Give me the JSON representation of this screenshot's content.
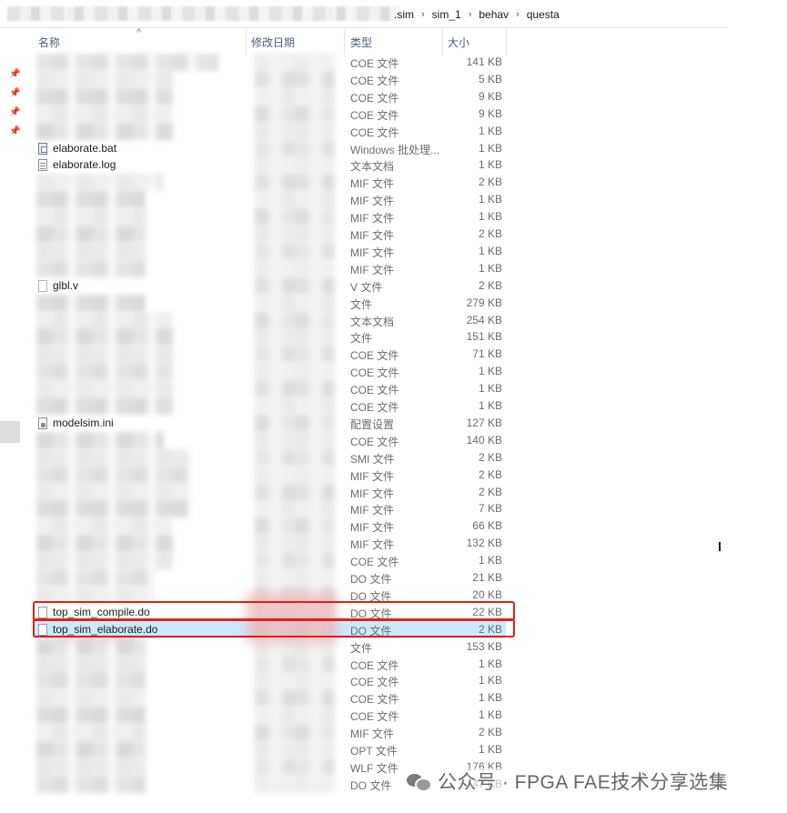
{
  "breadcrumb": {
    "segments": [
      ".sim",
      "sim_1",
      "behav",
      "questa"
    ]
  },
  "columns": {
    "name": "名称",
    "date": "修改日期",
    "type": "类型",
    "size": "大小"
  },
  "watermark": {
    "text": "公众号 · FPGA FAE技术分享选集"
  },
  "rows": [
    {
      "name": "",
      "type": "COE 文件",
      "size": "141 KB",
      "icon": "",
      "blur_w": 200
    },
    {
      "name": "",
      "type": "COE 文件",
      "size": "5 KB",
      "icon": "",
      "blur_w": 150
    },
    {
      "name": "",
      "type": "COE 文件",
      "size": "9 KB",
      "icon": "",
      "blur_w": 150
    },
    {
      "name": "",
      "type": "COE 文件",
      "size": "9 KB",
      "icon": "",
      "blur_w": 150
    },
    {
      "name": "",
      "type": "COE 文件",
      "size": "1 KB",
      "icon": "",
      "blur_w": 150
    },
    {
      "name": "elaborate.bat",
      "type": "Windows 批处理...",
      "size": "1 KB",
      "icon": "bat"
    },
    {
      "name": "elaborate.log",
      "type": "文本文档",
      "size": "1 KB",
      "icon": "log"
    },
    {
      "name": "",
      "type": "MIF 文件",
      "size": "2 KB",
      "icon": "",
      "blur_w": 140
    },
    {
      "name": "",
      "type": "MIF 文件",
      "size": "1 KB",
      "icon": "",
      "blur_w": 120
    },
    {
      "name": "",
      "type": "MIF 文件",
      "size": "1 KB",
      "icon": "",
      "blur_w": 120
    },
    {
      "name": "",
      "type": "MIF 文件",
      "size": "2 KB",
      "icon": "",
      "blur_w": 120
    },
    {
      "name": "",
      "type": "MIF 文件",
      "size": "1 KB",
      "icon": "",
      "blur_w": 120
    },
    {
      "name": "",
      "type": "MIF 文件",
      "size": "1 KB",
      "icon": "",
      "blur_w": 120
    },
    {
      "name": "glbl.v",
      "type": "V 文件",
      "size": "2 KB",
      "icon": "v"
    },
    {
      "name": "",
      "type": "文件",
      "size": "279 KB",
      "icon": "",
      "blur_w": 120
    },
    {
      "name": "",
      "type": "文本文档",
      "size": "254 KB",
      "icon": "",
      "blur_w": 150
    },
    {
      "name": "",
      "type": "文件",
      "size": "151 KB",
      "icon": "",
      "blur_w": 150
    },
    {
      "name": "",
      "type": "COE 文件",
      "size": "71 KB",
      "icon": "",
      "blur_w": 150
    },
    {
      "name": "",
      "type": "COE 文件",
      "size": "1 KB",
      "icon": "",
      "blur_w": 150
    },
    {
      "name": "",
      "type": "COE 文件",
      "size": "1 KB",
      "icon": "",
      "blur_w": 150
    },
    {
      "name": "",
      "type": "COE 文件",
      "size": "1 KB",
      "icon": "",
      "blur_w": 150
    },
    {
      "name": "modelsim.ini",
      "type": "配置设置",
      "size": "127 KB",
      "icon": "ini"
    },
    {
      "name": "",
      "type": "COE 文件",
      "size": "140 KB",
      "icon": "",
      "blur_w": 140
    },
    {
      "name": "",
      "type": "SMI 文件",
      "size": "2 KB",
      "icon": "",
      "blur_w": 170
    },
    {
      "name": "",
      "type": "MIF 文件",
      "size": "2 KB",
      "icon": "",
      "blur_w": 170
    },
    {
      "name": "",
      "type": "MIF 文件",
      "size": "2 KB",
      "icon": "",
      "blur_w": 170
    },
    {
      "name": "",
      "type": "MIF 文件",
      "size": "7 KB",
      "icon": "",
      "blur_w": 170
    },
    {
      "name": "",
      "type": "MIF 文件",
      "size": "66 KB",
      "icon": "",
      "blur_w": 150
    },
    {
      "name": "",
      "type": "MIF 文件",
      "size": "132 KB",
      "icon": "",
      "blur_w": 150
    },
    {
      "name": "",
      "type": "COE 文件",
      "size": "1 KB",
      "icon": "",
      "blur_w": 150
    },
    {
      "name": "",
      "type": "DO 文件",
      "size": "21 KB",
      "icon": "",
      "blur_w": 130
    },
    {
      "name": "",
      "type": "DO 文件",
      "size": "20 KB",
      "icon": "",
      "blur_w": 130
    },
    {
      "name": "top_sim_compile.do",
      "type": "DO 文件",
      "size": "22 KB",
      "icon": "do"
    },
    {
      "name": "top_sim_elaborate.do",
      "type": "DO 文件",
      "size": "2 KB",
      "icon": "do",
      "selected": true
    },
    {
      "name": "",
      "type": "文件",
      "size": "153 KB",
      "icon": "",
      "blur_w": 120
    },
    {
      "name": "",
      "type": "COE 文件",
      "size": "1 KB",
      "icon": "",
      "blur_w": 120
    },
    {
      "name": "",
      "type": "COE 文件",
      "size": "1 KB",
      "icon": "",
      "blur_w": 120
    },
    {
      "name": "",
      "type": "COE 文件",
      "size": "1 KB",
      "icon": "",
      "blur_w": 120
    },
    {
      "name": "",
      "type": "COE 文件",
      "size": "1 KB",
      "icon": "",
      "blur_w": 120
    },
    {
      "name": "",
      "type": "MIF 文件",
      "size": "2 KB",
      "icon": "",
      "blur_w": 120
    },
    {
      "name": "",
      "type": "OPT 文件",
      "size": "1 KB",
      "icon": "",
      "blur_w": 120
    },
    {
      "name": "",
      "type": "WLF 文件",
      "size": "176 KB",
      "icon": "",
      "blur_w": 120
    },
    {
      "name": "",
      "type": "DO 文件",
      "size": "47 KB",
      "icon": "",
      "blur_w": 120
    }
  ]
}
